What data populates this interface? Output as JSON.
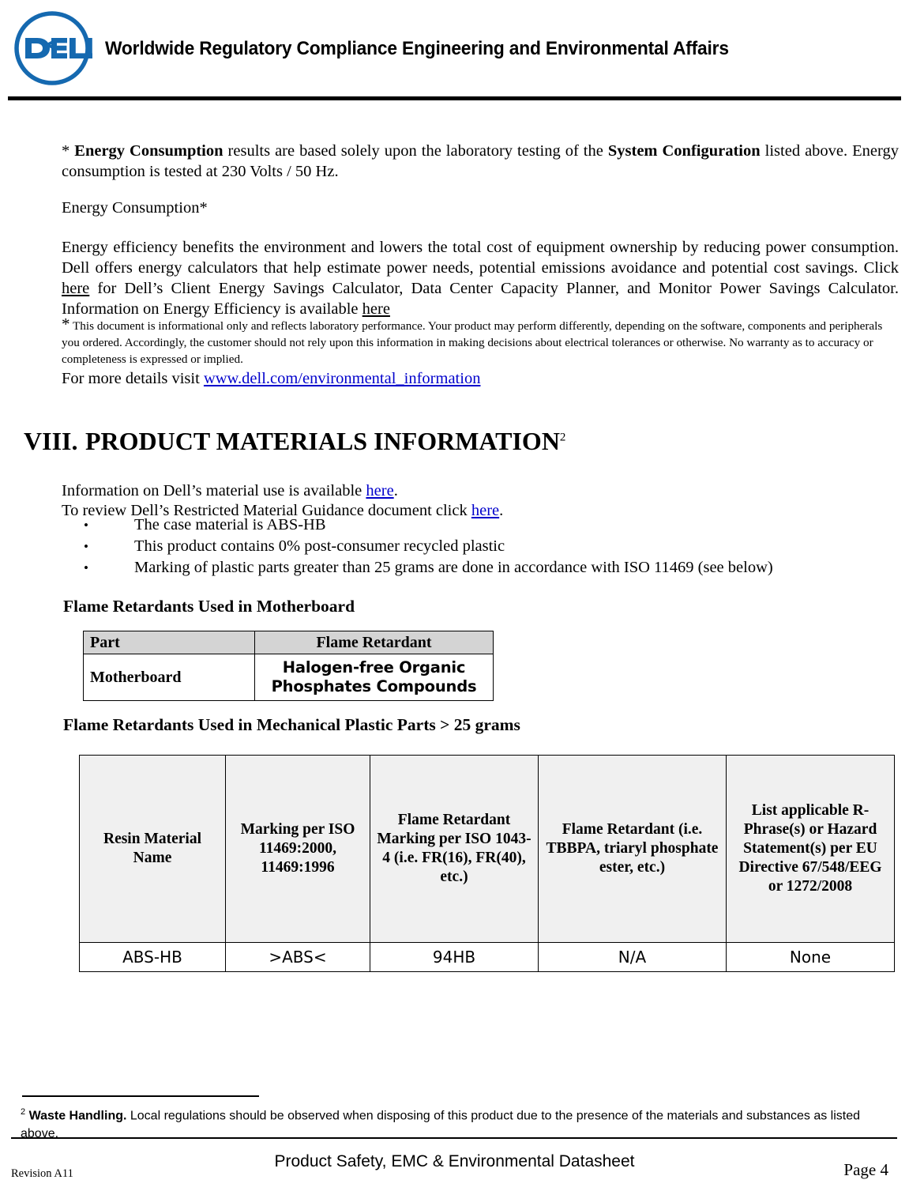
{
  "header": {
    "logo_text": "DELL",
    "logo_color": "#1569b0",
    "title": "Worldwide Regulatory Compliance Engineering and Environmental Affairs"
  },
  "body": {
    "energy_note": {
      "star": "* ",
      "bold1": "Energy Consumption",
      "text1": " results are based solely upon the laboratory testing of the ",
      "bold2": "System Configuration",
      "text2": " listed above. Energy consumption is tested at 230 Volts / 50 Hz."
    },
    "energy_heading": "Energy Consumption*",
    "efficiency_paragraph": {
      "part1": "Energy efficiency benefits the environment and lowers the total cost of equipment ownership by reducing power consumption. Dell offers energy calculators that help estimate power needs, potential emissions avoidance and potential cost savings. Click ",
      "link1": "here",
      "part2": " for Dell’s Client Energy Savings Calculator, Data Center Capacity Planner, and Monitor Power Savings Calculator. Information on Energy Efficiency is available ",
      "link2": "here"
    },
    "disclaimer": {
      "star": "*",
      "text": " This document is informational only and reflects laboratory performance. Your product may perform differently, depending on the software, components and peripherals you ordered.  Accordingly, the customer should not rely upon this information in making decisions about electrical tolerances or otherwise.  No warranty as to accuracy or completeness is expressed or implied."
    },
    "more_details": {
      "prefix": "For more details visit ",
      "link": "www.dell.com/environmental_information"
    }
  },
  "section": {
    "number": "VIII.",
    "title": "PRODUCT MATERIALS INFORMATION",
    "footnote_marker": "2"
  },
  "materials": {
    "line1": {
      "prefix": "Information on Dell’s material use is available ",
      "link": "here",
      "suffix": "."
    },
    "line2": {
      "prefix": "To review Dell’s Restricted Material Guidance document click ",
      "link": "here",
      "suffix": "."
    },
    "bullets": [
      "The case material is ABS-HB",
      "This product contains 0% post-consumer recycled plastic",
      "Marking of plastic parts greater than 25 grams are done in accordance with ISO 11469 (see below)"
    ]
  },
  "table1": {
    "heading": "Flame Retardants Used in Motherboard",
    "columns": [
      "Part",
      "Flame Retardant"
    ],
    "rows": [
      [
        "Motherboard",
        "Halogen-free Organic Phosphates Compounds"
      ]
    ]
  },
  "table2": {
    "heading": "Flame Retardants Used in Mechanical Plastic Parts > 25 grams",
    "columns": [
      "Resin Material Name",
      "Marking per ISO 11469:2000, 11469:1996",
      "Flame Retardant Marking per ISO 1043-4 (i.e. FR(16), FR(40), etc.)",
      "Flame Retardant (i.e. TBBPA, triaryl phosphate ester, etc.)",
      "List applicable R-Phrase(s) or Hazard Statement(s) per EU Directive 67/548/EEG or 1272/2008"
    ],
    "rows": [
      [
        "ABS-HB",
        ">ABS<",
        "94HB",
        "N/A",
        "None"
      ]
    ]
  },
  "footnote": {
    "marker": "2",
    "bold": "Waste Handling.",
    "text": " Local regulations should be observed when disposing of this product due to the presence of the materials and substances as listed above."
  },
  "footer": {
    "revision": "Revision A11",
    "center": "Product Safety, EMC & Environmental Datasheet",
    "page": "Page 4"
  }
}
